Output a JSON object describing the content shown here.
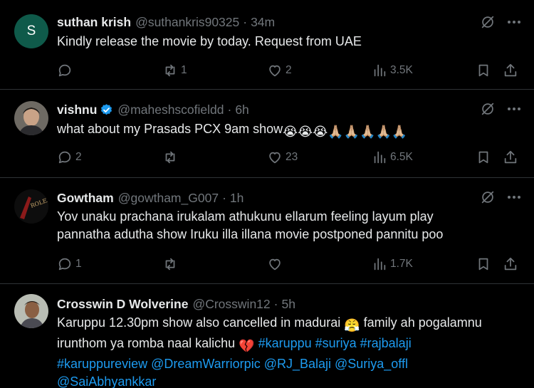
{
  "posts": [
    {
      "avatar_letter": "S",
      "avatar_color": "#0f5a4a",
      "name": "suthan krish",
      "handle": "@suthankris90325",
      "time": "34m",
      "text": "Kindly release the movie by today. Request from UAE",
      "replies": "",
      "reposts": "1",
      "likes": "2",
      "views": "3.5K"
    },
    {
      "name": "vishnu",
      "verified": true,
      "handle": "@maheshscofieldd",
      "time": "6h",
      "text": "what about my Prasads PCX 9am show",
      "emojis": "😭😭😭🙏🏼🙏🏼🙏🏼🙏🏼🙏🏼",
      "replies": "2",
      "reposts": "",
      "likes": "23",
      "views": "6.5K"
    },
    {
      "name": "Gowtham",
      "handle": "@gowtham_G007",
      "time": "1h",
      "text_line1": "Yov unaku prachana irukalam athukunu ellarum feeling layum play",
      "text_line2": "pannatha adutha show Iruku illa illana movie postponed pannitu poo",
      "replies": "1",
      "reposts": "",
      "likes": "",
      "views": "1.7K"
    },
    {
      "name": "Crosswin D Wolverine",
      "handle": "@Crosswin12",
      "time": "5h",
      "line1_a": "Karuppu 12.30pm show also cancelled in madurai ",
      "line1_emoji": "😤",
      "line1_b": " family ah pogalamnu",
      "line2_a": "irunthom ya romba naal kalichu ",
      "line2_emoji": "💔",
      "line2_links": " #karuppu #suriya #rajbalaji",
      "line3": "#karuppureview @DreamWarriorpic @RJ_Balaji @Suriya_offl",
      "line4": "@SaiAbhyankkar"
    }
  ],
  "colors": {
    "background": "#000000",
    "text": "#e7e9ea",
    "secondary": "#71767b",
    "link": "#1d9bf0",
    "verified": "#1d9bf0",
    "divider": "#2f3336"
  }
}
